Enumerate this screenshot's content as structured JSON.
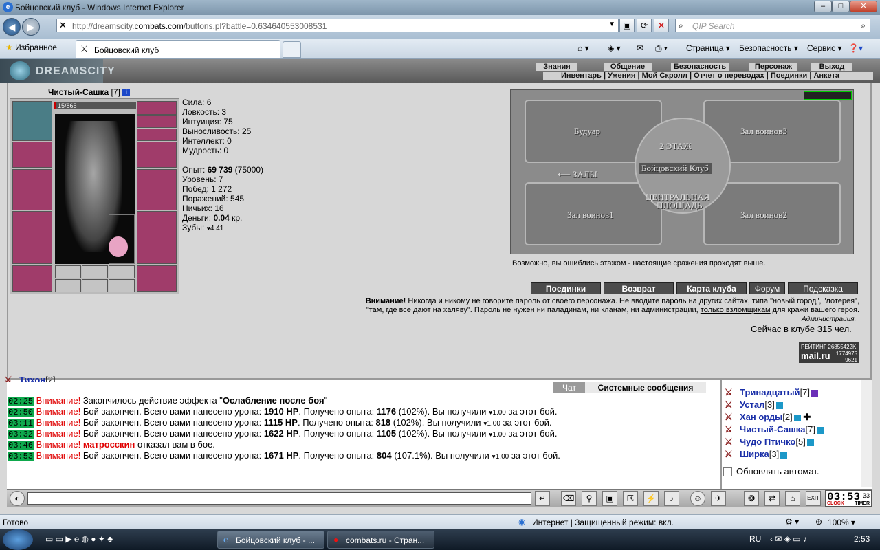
{
  "window": {
    "title": "Бойцовский клуб - Windows Internet Explorer"
  },
  "browser": {
    "url_prefix": "http://dreamscity.",
    "url_domain": "combats.com",
    "url_suffix": "/buttons.pl?battle=0.634640553008531",
    "search_placeholder": "QIP Search",
    "favorites": "Избранное",
    "tab_title": "Бойцовский клуб",
    "cmd_page": "Страница ▾",
    "cmd_security": "Безопасность ▾",
    "cmd_service": "Сервис ▾"
  },
  "site": {
    "logo": "DREAMSCITY",
    "menu": [
      "Знания",
      "Общение",
      "Безопасность",
      "Персонаж",
      "Выход"
    ],
    "submenu": "Инвентарь | Умения | Мой Скролл | Отчет о переводах | Поединки | Анкета"
  },
  "character": {
    "name": "Чистый-Сашка",
    "level": "[7]",
    "hp": "15/865",
    "stats": [
      "Сила: 6",
      "Ловкость: 3",
      "Интуиция: 75",
      "Выносливость: 25",
      "Интеллект: 0",
      "Мудрость: 0"
    ],
    "exp_label": "Опыт: ",
    "exp_value": "69 739",
    "exp_next": " (75000)",
    "level_line": "Уровень: 7",
    "wins": "Побед: 1 272",
    "losses": "Поражений: 545",
    "draws": "Ничьих: 16",
    "money_label": "Деньги: ",
    "money_value": "0.04",
    "money_unit": " кр.",
    "teeth_label": "Зубы: ",
    "teeth_value": "4.41"
  },
  "map": {
    "floor": "2 ЭТАЖ",
    "boudoir": "Будуар",
    "hall3": "Зал воинов3",
    "halls": "ЗАЛЫ",
    "club": "Бойцовский Клуб",
    "central_1": "ЦЕНТРАЛЬНАЯ",
    "central_2": "ПЛОЩАДЬ",
    "hall1": "Зал воинов1",
    "hall2": "Зал воинов2",
    "tip": "Возможно, вы ошиблись этажом - настоящие сражения проходят выше."
  },
  "buttons": {
    "fights": "Поединки",
    "back": "Возврат",
    "club_map": "Карта клуба",
    "forum": "Форум",
    "hint": "Подсказка"
  },
  "warning": {
    "bold": "Внимание!",
    "text1": " Никогда и никому не говорите пароль от своего персонажа. Не вводите пароль на других сайтах, типа \"новый город\", \"лотерея\",",
    "text2": "\"там, где все дают на халяву\". Пароль не нужен ни паладинам, ни кланам, ни администрации, ",
    "link": "только взломщикам",
    "text3": " для кражи вашего героя.",
    "admin": "Администрация.",
    "online": "Сейчас в клубе 315 чел."
  },
  "rating": {
    "label": "РЕЙТИНГ 26855422K",
    "brand": "mail.ru",
    "n1": "1774975",
    "n2": "9621"
  },
  "chat": {
    "tab_chat": "Чат",
    "tab_system": "Системные сообщения",
    "lines": [
      {
        "time": "02:25",
        "warn": "Внимание!",
        "p1": " Закончилось действие эффекта \"",
        "b1": "Ослабление после боя",
        "p2": "\"",
        "b2": "",
        "p3": "",
        "b3": "",
        "p4": "",
        "p5": ""
      },
      {
        "time": "02:50",
        "warn": "Внимание!",
        "p1": " Бой закончен. Всего вами нанесено урона: ",
        "b1": "1910 HP",
        "p2": ". Получено опыта: ",
        "b2": "1176",
        "p3": " (102%). Вы получили ",
        "b3": "1.00",
        "p4": " за этот бой.",
        "p5": ""
      },
      {
        "time": "03:11",
        "warn": "Внимание!",
        "p1": " Бой закончен. Всего вами нанесено урона: ",
        "b1": "1115 HP",
        "p2": ". Получено опыта: ",
        "b2": "818",
        "p3": " (102%). Вы получили ",
        "b3": "1.00",
        "p4": " за этот бой.",
        "p5": ""
      },
      {
        "time": "03:32",
        "warn": "Внимание!",
        "p1": " Бой закончен. Всего вами нанесено урона: ",
        "b1": "1622 HP",
        "p2": ". Получено опыта: ",
        "b2": "1105",
        "p3": " (102%). Вы получили ",
        "b3": "1.00",
        "p4": " за этот бой.",
        "p5": ""
      },
      {
        "time": "03:46",
        "warn": "Внимание!",
        "name": "матросскин",
        "rest": " отказал вам в бое."
      },
      {
        "time": "03:53",
        "warn": "Внимание!",
        "p1": " Бой закончен. Всего вами нанесено урона: ",
        "b1": "1671 HP",
        "p2": ". Получено опыта: ",
        "b2": "804",
        "p3": " (107.1%). Вы получили ",
        "b3": "1.00",
        "p4": " за этот бой.",
        "p5": ""
      }
    ]
  },
  "users": {
    "list": [
      {
        "name": "Тихон",
        "level": "[2]"
      },
      {
        "name": "Тринадцатый",
        "level": "[7]"
      },
      {
        "name": "Устал",
        "level": "[3]"
      },
      {
        "name": "Хан орды",
        "level": "[2]"
      },
      {
        "name": "Чистый-Сашка",
        "level": "[7]"
      },
      {
        "name": "Чудо Птичко",
        "level": "[5]"
      },
      {
        "name": "Ширка",
        "level": "[3]"
      }
    ],
    "auto_update": "Обновлять автомат."
  },
  "clock": {
    "time": "03:53",
    "seconds": "33",
    "label_clock": "CLOCK",
    "label_timer": "TIMER"
  },
  "status": {
    "left": "Готово",
    "zone": "Интернет | Защищенный режим: вкл.",
    "zoom": "100%"
  },
  "taskbar": {
    "task1": "Бойцовский клуб - ...",
    "task2": "combats.ru - Стран...",
    "lang": "RU",
    "time": "2:53"
  }
}
